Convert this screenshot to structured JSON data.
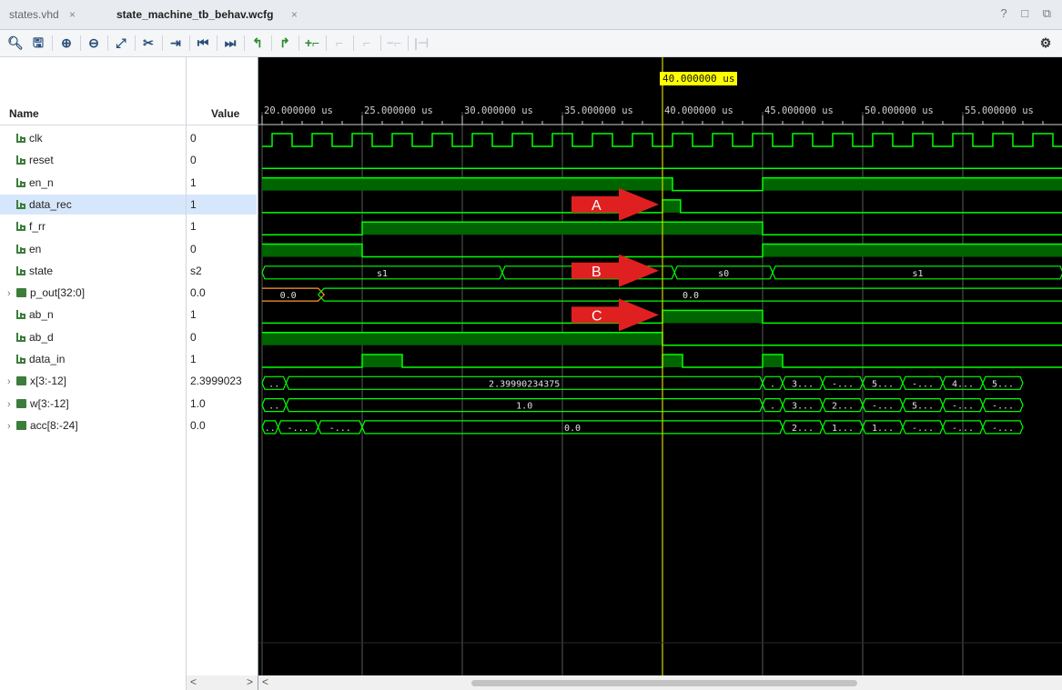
{
  "tabs": [
    {
      "label": "states.vhd",
      "close": "×",
      "active": false
    },
    {
      "label": "state_machine_tb_behav.wcfg",
      "close": "×",
      "active": true
    }
  ],
  "window_controls": "? □ ⧉",
  "toolbar": {
    "icons": [
      "search-icon",
      "save-icon",
      "zoom-in-icon",
      "zoom-out-icon",
      "zoom-fit-icon",
      "swap-icon",
      "go-to-cursor-icon",
      "go-to-start-icon",
      "go-to-end-icon",
      "previous-transition-icon",
      "next-transition-icon",
      "add-marker-icon",
      "previous-marker-icon",
      "next-marker-icon",
      "delete-marker-icon",
      "delete-all-markers-icon",
      "settings-icon"
    ]
  },
  "columns": {
    "name": "Name",
    "value": "Value"
  },
  "signals": [
    {
      "name": "clk",
      "value": "0",
      "kind": "bit"
    },
    {
      "name": "reset",
      "value": "0",
      "kind": "bit"
    },
    {
      "name": "en_n",
      "value": "1",
      "kind": "bit"
    },
    {
      "name": "data_rec",
      "value": "1",
      "kind": "bit",
      "selected": true
    },
    {
      "name": "f_rr",
      "value": "1",
      "kind": "bit"
    },
    {
      "name": "en",
      "value": "0",
      "kind": "bit"
    },
    {
      "name": "state",
      "value": "s2",
      "kind": "bit"
    },
    {
      "name": "p_out[32:0]",
      "value": "0.0",
      "kind": "bus",
      "expandable": true
    },
    {
      "name": "ab_n",
      "value": "1",
      "kind": "bit2"
    },
    {
      "name": "ab_d",
      "value": "0",
      "kind": "bit2"
    },
    {
      "name": "data_in",
      "value": "1",
      "kind": "bit"
    },
    {
      "name": "x[3:-12]",
      "value": "2.3999023",
      "kind": "bus",
      "expandable": true
    },
    {
      "name": "w[3:-12]",
      "value": "1.0",
      "kind": "bus",
      "expandable": true
    },
    {
      "name": "acc[8:-24]",
      "value": "0.0",
      "kind": "bus",
      "expandable": true
    }
  ],
  "time_axis": {
    "labels": [
      "20.000000 us",
      "25.000000 us",
      "30.000000 us",
      "35.000000 us",
      "40.000000 us",
      "45.000000 us",
      "50.000000 us",
      "55.000000 us"
    ],
    "cursor": "40.000000 us"
  },
  "bus_text": {
    "state": [
      "s1",
      "s2",
      "s0",
      "s1"
    ],
    "p_out": [
      "0.0",
      "0.0"
    ],
    "x": [
      "..",
      "2.39990234375",
      ".",
      "3...",
      "-...",
      "5...",
      "-...",
      "4...",
      "5..."
    ],
    "w": [
      "..",
      "1.0",
      ".",
      "3...",
      "2...",
      "-...",
      "5...",
      "-...",
      "-..."
    ],
    "acc": [
      "..",
      "-...",
      "-...",
      "0.0",
      "2...",
      "1...",
      "1...",
      "-...",
      "-...",
      "-..."
    ]
  },
  "annotations": [
    "A",
    "B",
    "C"
  ],
  "scroll": {
    "left": "<",
    "right": ">"
  },
  "colors": {
    "wave": "#00ff00",
    "bus_fill": "#006400",
    "cursor": "#d4d400",
    "arrow": "#e02020",
    "grid": "#5a5a5a"
  }
}
